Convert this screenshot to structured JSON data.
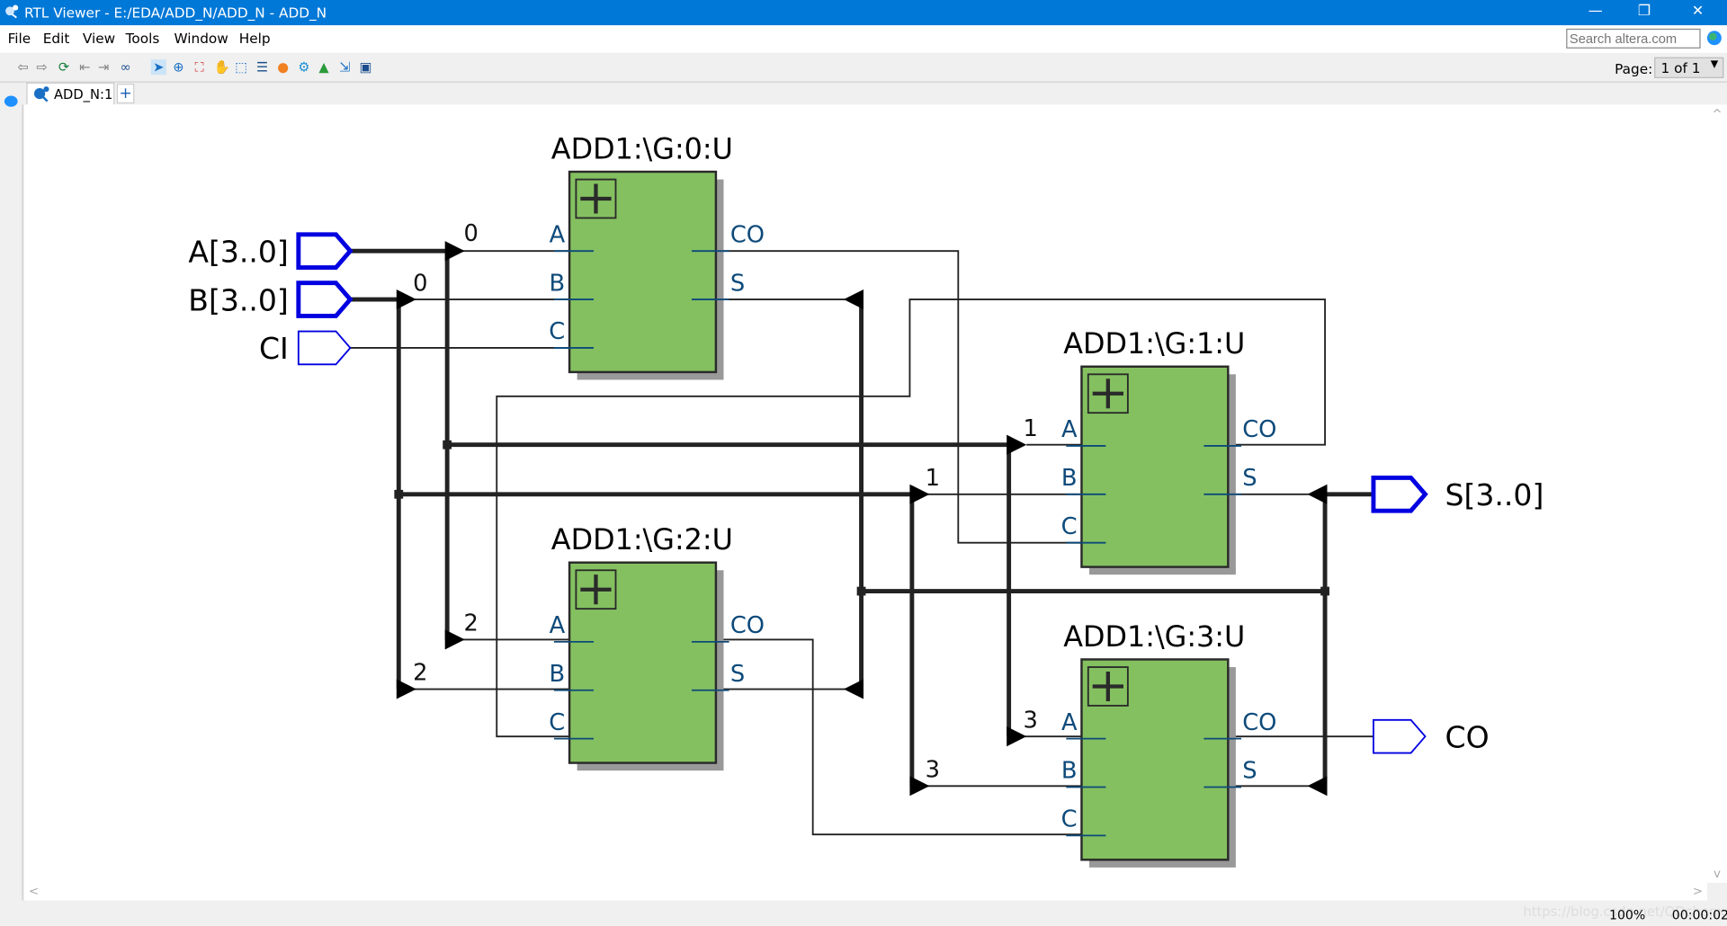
{
  "window": {
    "title": "RTL Viewer - E:/EDA/ADD_N/ADD_N - ADD_N",
    "minimize": "—",
    "restore": "❐",
    "close": "✕"
  },
  "menu": [
    {
      "label": "File"
    },
    {
      "label": "Edit"
    },
    {
      "label": "View"
    },
    {
      "label": "Tools"
    },
    {
      "label": "Window"
    },
    {
      "label": "Help"
    }
  ],
  "search": {
    "placeholder": "Search altera.com"
  },
  "toolbar": {
    "icons": [
      "back-icon",
      "forward-icon",
      "refresh-icon",
      "collapse-icon",
      "expand-icon",
      "find-icon",
      "select-icon",
      "zoom-icon",
      "fit-icon",
      "hand-icon",
      "marquee-icon",
      "hierarchy-icon",
      "palette-icon",
      "settings-icon",
      "netlist-icon",
      "export-icon",
      "page-icon"
    ],
    "page_label": "Page:",
    "page_value": "1 of 1"
  },
  "tabs": [
    {
      "label": "ADD_N:1"
    }
  ],
  "add_tab": "+",
  "schematic": {
    "blocks": [
      {
        "name": "ADD1:\\G:0:U"
      },
      {
        "name": "ADD1:\\G:1:U"
      },
      {
        "name": "ADD1:\\G:2:U"
      },
      {
        "name": "ADD1:\\G:3:U"
      }
    ],
    "block_ports": {
      "inputs": [
        "A",
        "B",
        "C"
      ],
      "outputs": [
        "CO",
        "S"
      ]
    },
    "inputs": [
      "A[3..0]",
      "B[3..0]",
      "CI"
    ],
    "outputs": [
      "S[3..0]",
      "CO"
    ],
    "bit_labels": [
      "0",
      "0",
      "1",
      "1",
      "2",
      "2",
      "3",
      "3"
    ],
    "colors": {
      "block_fill": "#84c060",
      "bus_port": "#0000e0",
      "port_label": "#0d4a7a",
      "wire": "#222222"
    }
  },
  "status": {
    "zoom": "100%",
    "time": "00:00:02",
    "watermark": "https://blog.csdn.net/QDchenxr"
  }
}
